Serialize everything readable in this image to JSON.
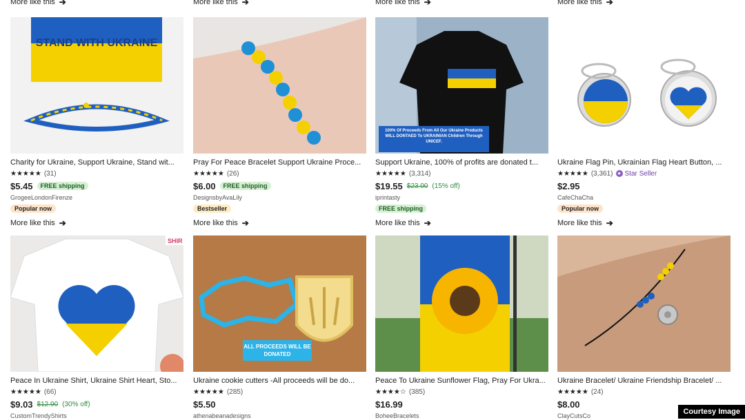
{
  "more_like_this_label": "More like this",
  "arrow_glyph": "➔",
  "shipping_label": "FREE shipping",
  "star_seller_label": "Star Seller",
  "watermark": "Courtesy Image",
  "colors": {
    "ukraine_blue": "#1f5fbf",
    "ukraine_yellow": "#f5d000",
    "free_shipping_bg": "#d6f0d4",
    "discount_green": "#2e8b3e",
    "star_seller_purple": "#6b3fa0"
  },
  "products": [
    {
      "title": "Charity for Ukraine, Support Ukraine, Stand wit...",
      "stars": "★★★★★",
      "reviews": "(31)",
      "price": "$5.45",
      "free_shipping": true,
      "shop": "GrogeeLondonFirenze",
      "badge": "Popular now",
      "image_text": "STAND WITH UKRAINE"
    },
    {
      "title": "Pray For Peace Bracelet Support Ukraine Proce...",
      "stars": "★★★★★",
      "reviews": "(26)",
      "price": "$6.00",
      "free_shipping": true,
      "shop": "DesignsbyAvaLily",
      "badge": "Bestseller"
    },
    {
      "title": "Support Ukraine, 100% of profits are donated t...",
      "stars": "★★★★★",
      "reviews": "(3,314)",
      "price": "$19.55",
      "original_price": "$23.00",
      "discount": "(15% off)",
      "shop": "iprintasty",
      "shipping_below": true,
      "image_text": "100% Of Proceeds From All Our Ukraine Products WILL DONTAED To UKRAINIAN Children Through UNICEF."
    },
    {
      "title": "Ukraine Flag Pin, Ukrainian Flag Heart Button, ...",
      "stars": "★★★★★",
      "reviews": "(3,361)",
      "star_seller": true,
      "price": "$2.95",
      "shop": "CafeChaCha",
      "badge": "Popular now"
    },
    {
      "title": "Peace In Ukraine Shirt, Ukraine Shirt Heart, Sto...",
      "stars": "★★★★★",
      "reviews": "(66)",
      "price": "$9.03",
      "original_price": "$12.90",
      "discount": "(30% off)",
      "shop": "CustomTrendyShirts",
      "image_text": "SHIR"
    },
    {
      "title": "Ukraine cookie cutters -All proceeds will be do...",
      "stars": "★★★★★",
      "reviews": "(285)",
      "price": "$5.50",
      "shop": "athenabeanadesigns",
      "image_text": "ALL PROCEEDS WILL BE DONATED"
    },
    {
      "title": "Peace To Ukraine Sunflower Flag, Pray For Ukra...",
      "stars": "★★★★☆",
      "reviews": "(385)",
      "price": "$16.99",
      "shop": "BoheeBracelets"
    },
    {
      "title": "Ukraine Bracelet/ Ukraine Friendship Bracelet/ ...",
      "stars": "★★★★★",
      "reviews": "(24)",
      "price": "$8.00",
      "shop": "ClayCutsCo"
    }
  ]
}
